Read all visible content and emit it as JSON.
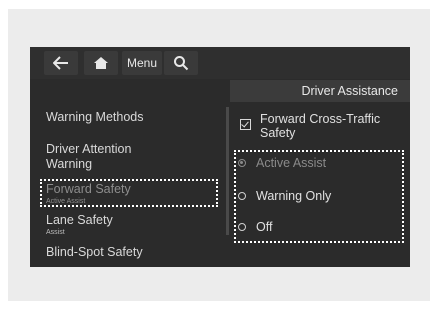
{
  "topbar": {
    "back_icon": "back-arrow-icon",
    "home_icon": "home-icon",
    "menu_label": "Menu",
    "search_icon": "search-icon"
  },
  "section_title": "Driver Assistance",
  "left_menu": {
    "items": [
      {
        "label": "Warning Methods",
        "sub": ""
      },
      {
        "label": "Driver Attention Warning",
        "sub": ""
      },
      {
        "label": "Forward Safety",
        "sub": "Active Assist"
      },
      {
        "label": "Lane Safety",
        "sub": "Assist"
      },
      {
        "label": "Blind-Spot Safety",
        "sub": ""
      }
    ],
    "selected_index": 2
  },
  "options": {
    "checkbox_label": "Forward Cross-Traffic Safety",
    "radios": [
      {
        "label": "Active Assist",
        "selected": true
      },
      {
        "label": "Warning Only",
        "selected": false
      },
      {
        "label": "Off",
        "selected": false
      }
    ]
  },
  "colors": {
    "screen_bg": "#2b2b2b",
    "highlight_border": "#ffffff"
  }
}
